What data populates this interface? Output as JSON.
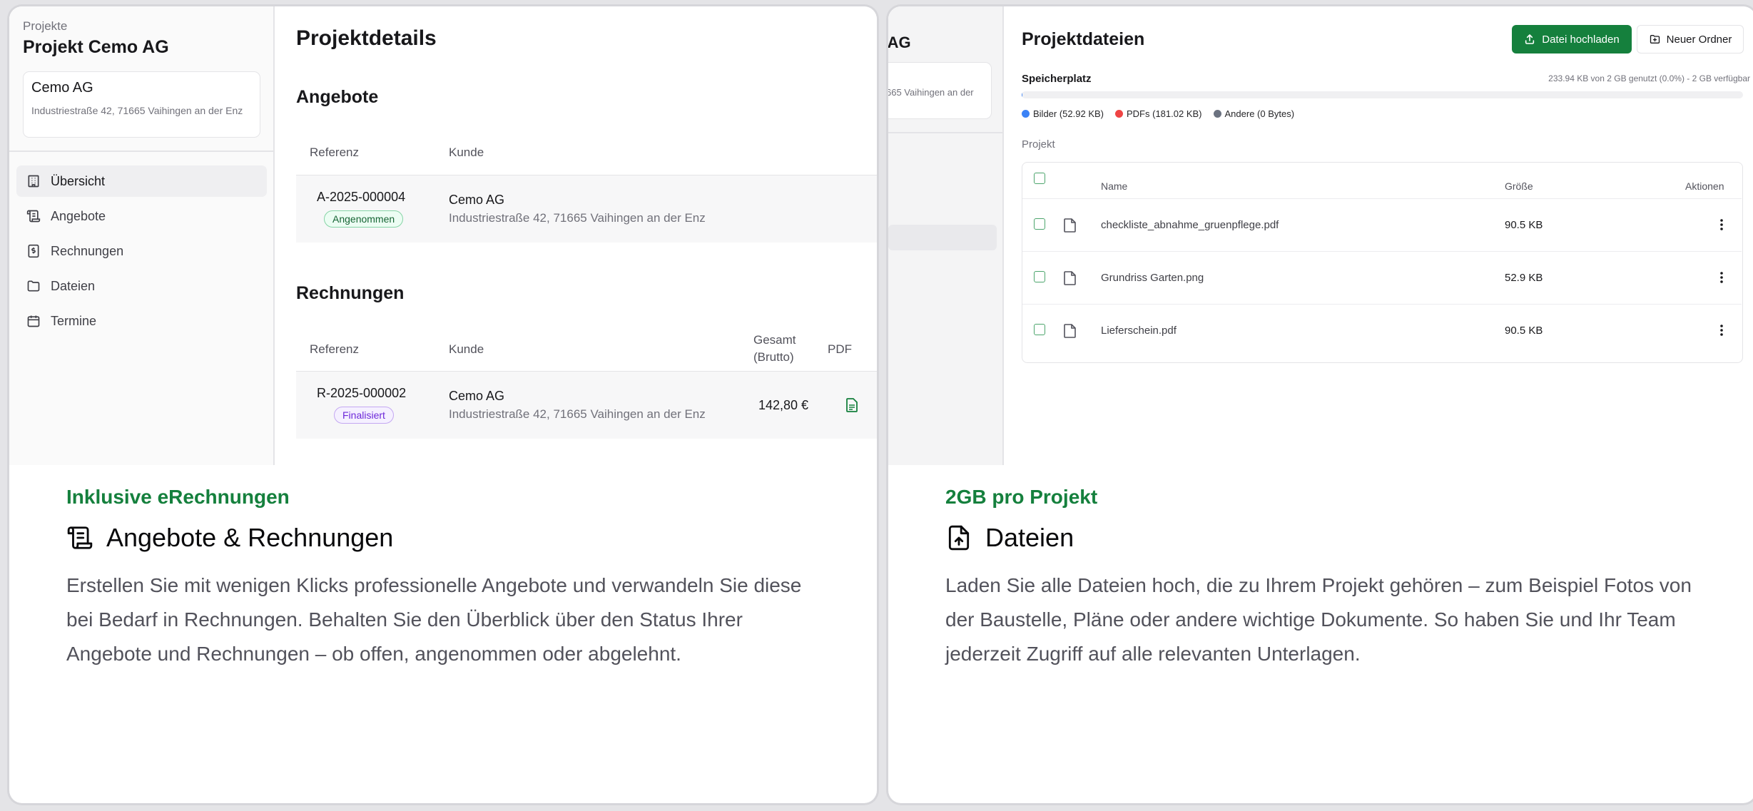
{
  "left_card": {
    "sidebar": {
      "breadcrumb": "Projekte",
      "project_title": "Projekt Cemo AG",
      "customer": {
        "name": "Cemo AG",
        "address": "Industriestraße 42, 71665 Vaihingen an der Enz"
      },
      "nav": [
        {
          "label": "Übersicht",
          "icon": "building-icon"
        },
        {
          "label": "Angebote",
          "icon": "scroll-icon"
        },
        {
          "label": "Rechnungen",
          "icon": "receipt-icon"
        },
        {
          "label": "Dateien",
          "icon": "folder-icon"
        },
        {
          "label": "Termine",
          "icon": "calendar-icon"
        }
      ]
    },
    "main": {
      "page_title": "Projektdetails",
      "offers": {
        "heading": "Angebote",
        "columns": [
          "Referenz",
          "Kunde"
        ],
        "rows": [
          {
            "reference": "A-2025-000004",
            "status": "Angenommen",
            "customer": "Cemo AG",
            "address": "Industriestraße 42, 71665 Vaihingen an der Enz"
          }
        ]
      },
      "invoices": {
        "heading": "Rechnungen",
        "columns": [
          "Referenz",
          "Kunde",
          "Gesamt",
          "(Brutto)",
          "PDF"
        ],
        "rows": [
          {
            "reference": "R-2025-000002",
            "status": "Finalisiert",
            "customer": "Cemo AG",
            "address": "Industriestraße 42, 71665 Vaihingen an der Enz",
            "total": "142,80 €"
          }
        ]
      }
    },
    "feature": {
      "eyebrow": "Inklusive eRechnungen",
      "title": "Angebote & Rechnungen",
      "text": "Erstellen Sie mit wenigen Klicks professionelle Angebote und verwandeln Sie diese bei Bedarf in Rechnungen. Behalten Sie den Überblick über den Status Ihrer Angebote und Rechnungen – ob offen, angenommen oder abgelehnt."
    }
  },
  "right_card": {
    "sidebar_partial": {
      "title_fragment": "- AG",
      "address_fragment": "665 Vaihingen an der"
    },
    "main": {
      "title": "Projektdateien",
      "upload_button": "Datei hochladen",
      "new_folder_button": "Neuer Ordner",
      "storage": {
        "label": "Speicherplatz",
        "info": "233.94 KB von 2 GB genutzt (0.0%) - 2 GB verfügbar",
        "used_fraction": 0.0001,
        "legend": [
          {
            "label": "Bilder (52.92 KB)",
            "color": "#3b82f6"
          },
          {
            "label": "PDFs (181.02 KB)",
            "color": "#ef4444"
          },
          {
            "label": "Andere (0 Bytes)",
            "color": "#6b7280"
          }
        ]
      },
      "folder_label": "Projekt",
      "columns": {
        "name": "Name",
        "size": "Größe",
        "actions": "Aktionen"
      },
      "files": [
        {
          "name": "checkliste_abnahme_gruenpflege.pdf",
          "size": "90.5 KB"
        },
        {
          "name": "Grundriss Garten.png",
          "size": "52.9 KB"
        },
        {
          "name": "Lieferschein.pdf",
          "size": "90.5 KB"
        }
      ]
    },
    "feature": {
      "eyebrow": "2GB pro Projekt",
      "title": "Dateien",
      "text": "Laden Sie alle Dateien hoch, die zu Ihrem Projekt gehören – zum Beispiel Fotos von der Baustelle, Pläne oder andere wichtige Dokumente. So haben Sie und Ihr Team jederzeit Zugriff auf alle relevanten Unterlagen."
    }
  },
  "colors": {
    "accent_green": "#15803d",
    "background": "#e4e4e7"
  }
}
